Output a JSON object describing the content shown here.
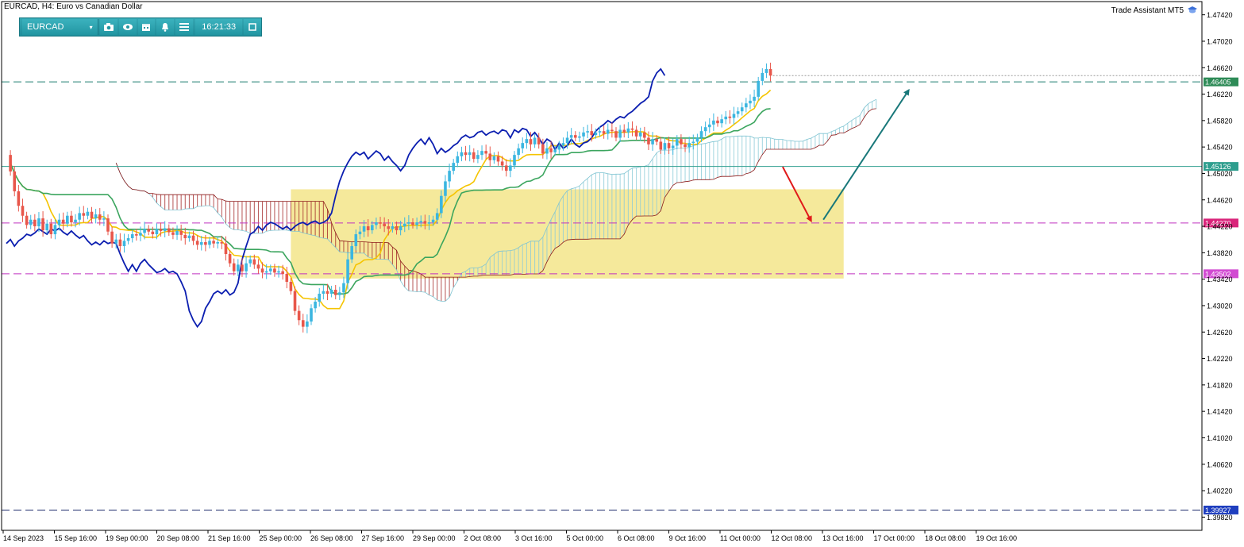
{
  "header": {
    "title": "EURCAD, H4:  Euro vs Canadian Dollar",
    "assistant_label": "Trade Assistant MT5"
  },
  "toolbar": {
    "symbol": "EURCAD",
    "time": "16:21:33",
    "icons": [
      "camera-icon",
      "eye-icon",
      "calendar-icon",
      "bell-icon",
      "menu-icon",
      "window-icon"
    ]
  },
  "colors": {
    "up_candle": "#3bb6e0",
    "down_candle": "#e8574b",
    "tenkan": "#f5c400",
    "kijun": "#3ba55e",
    "chikou": "#0b1eb0",
    "zone": "#f2e27a",
    "price_line": "#2e9e8e",
    "magenta_line": "#c032c0",
    "teal_dash": "#1f7d70",
    "navy_dash": "#1f2d6e",
    "arrow_down": "#e01a1a",
    "arrow_up": "#19787a"
  },
  "chart_data": {
    "type": "candlestick",
    "symbol": "EURCAD",
    "timeframe": "H4",
    "ylim": [
      1.3962,
      1.4762
    ],
    "y_ticks": [
      "1.47420",
      "1.47020",
      "1.46620",
      "1.46220",
      "1.45820",
      "1.45420",
      "1.45020",
      "1.44620",
      "1.44220",
      "1.43820",
      "1.43420",
      "1.43020",
      "1.42620",
      "1.42220",
      "1.41820",
      "1.41420",
      "1.41020",
      "1.40620",
      "1.40220",
      "1.39820"
    ],
    "x_labels": [
      "14 Sep 2023",
      "15 Sep 16:00",
      "19 Sep 00:00",
      "20 Sep 08:00",
      "21 Sep 16:00",
      "25 Sep 00:00",
      "26 Sep 08:00",
      "27 Sep 16:00",
      "29 Sep 00:00",
      "2 Oct 08:00",
      "3 Oct 16:00",
      "5 Oct 00:00",
      "6 Oct 08:00",
      "9 Oct 16:00",
      "11 Oct 00:00",
      "12 Oct 08:00",
      "13 Oct 16:00",
      "17 Oct 00:00",
      "18 Oct 08:00",
      "19 Oct 16:00"
    ],
    "levels": [
      {
        "label": "1.46405",
        "value": 1.46405,
        "style": "dash",
        "color": "#1f7d70",
        "badge": "#2e8b57"
      },
      {
        "label": "1.45126",
        "value": 1.45126,
        "style": "solid",
        "color": "#2e9e8e",
        "badge": "#2e9e8e"
      },
      {
        "label": "1.44270",
        "value": 1.4427,
        "style": "dash",
        "color": "#c032c0",
        "badge": "#d9247a"
      },
      {
        "label": "1.43502",
        "value": 1.43502,
        "style": "dash",
        "color": "#c032c0",
        "badge": "#d24bd2"
      },
      {
        "label": "1.39927",
        "value": 1.39927,
        "style": "dash",
        "color": "#1f2d6e",
        "badge": "#1f3fbf"
      }
    ],
    "zone": {
      "from_index": 70,
      "to_index": 206,
      "high": 1.4478,
      "low": 1.4343
    },
    "arrows": [
      {
        "from": [
          191,
          1.4512
        ],
        "to": [
          198,
          1.443
        ],
        "color": "#e01a1a"
      },
      {
        "from": [
          201,
          1.4432
        ],
        "to": [
          222,
          1.4628
        ],
        "color": "#19787a"
      }
    ],
    "candles": {
      "start": 1.453,
      "steps": [
        -0.0025,
        -0.003,
        -0.0022,
        -0.0015,
        -0.0014,
        0.0008,
        -0.001,
        0.0012,
        -0.0018,
        0.001,
        -0.0016,
        0.0014,
        0.0008,
        -0.0006,
        0.0012,
        -0.001,
        0.0004,
        0.001,
        -0.0004,
        0.0006,
        -0.001,
        0.0006,
        -0.0008,
        0.0002,
        -0.002,
        -0.0018,
        0.0006,
        -0.001,
        0.0008,
        0.0004,
        0.0006,
        -0.0002,
        0.0004,
        0.0006,
        -0.0004,
        -0.0004,
        0.0008,
        -0.0003,
        0.0004,
        -0.0006,
        -0.0004,
        0.0006,
        -0.0006,
        -0.0005,
        0.0004,
        -0.0008,
        -0.0006,
        0.0004,
        -0.0004,
        0.0006,
        -0.0004,
        0.0002,
        -0.0002,
        -0.0016,
        -0.0014,
        -0.0012,
        0.001,
        -0.001,
        0.0012,
        0.0006,
        -0.0008,
        -0.0006,
        -0.0006,
        0.0002,
        0.0004,
        -0.0006,
        0.0002,
        -0.0004,
        -0.0012,
        -0.0014,
        -0.003,
        -0.0014,
        -0.001,
        0.0008,
        0.002,
        0.001,
        0.0012,
        0.0004,
        -0.0004,
        0.0006,
        -0.0008,
        0.0004,
        0.0014,
        0.0036,
        0.002,
        0.0018,
        0.0004,
        0.0008,
        -0.0006,
        0.0008,
        0.0004,
        -0.0002,
        -0.0004,
        -0.0004,
        0.0004,
        -0.0006,
        0.0006,
        0.0004,
        0.0002,
        -0.0004,
        0.0004,
        0.0002,
        -0.0004,
        0.0002,
        0.0004,
        0.001,
        0.0026,
        0.0022,
        0.0016,
        0.0012,
        0.001,
        0.0006,
        -0.0004,
        0.0004,
        -0.001,
        0.0006,
        0.0006,
        -0.0004,
        -0.001,
        0.0006,
        -0.0008,
        -0.0006,
        -0.0008,
        0.0008,
        0.0016,
        0.001,
        0.0008,
        0.0006,
        -0.0008,
        0.001,
        -0.001,
        -0.0014,
        0.0008,
        -0.0006,
        0.0004,
        0.0006,
        0.0004,
        0.0008,
        0.0004,
        -0.0004,
        0.0002,
        0.0006,
        0.0002,
        -0.0006,
        0.0004,
        0.0002,
        -0.0004,
        0.0006,
        -0.0002,
        -0.001,
        0.0012,
        -0.0004,
        0.0006,
        -0.0002,
        -0.001,
        0.0006,
        -0.0008,
        -0.001,
        0.0008,
        -0.0004,
        -0.0012,
        0.001,
        -0.0008,
        0.0004,
        0.001,
        -0.0008,
        -0.0004,
        0.0006,
        0.0002,
        0.0006,
        0.001,
        0.0006,
        0.0004,
        0.0006,
        -0.0004,
        0.0006,
        0.0004,
        -0.0002,
        0.0006,
        0.0004,
        0.0006,
        0.0006,
        0.0004,
        0.0006,
        0.0024,
        0.0012,
        0.0006,
        -0.001
      ]
    }
  }
}
